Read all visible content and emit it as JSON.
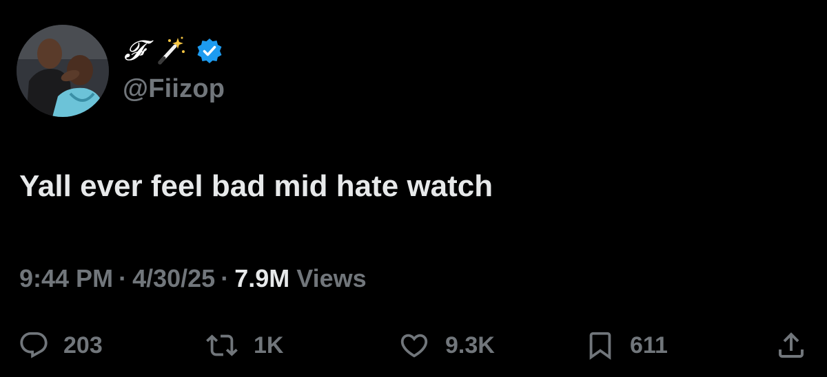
{
  "author": {
    "display_name_glyph": "𝓕",
    "handle": "@Fiizop",
    "verified": true,
    "badge_color": "#1d9bf0",
    "emoji_icon": "magic-wand-icon"
  },
  "tweet": {
    "text": "Yall ever feel bad mid hate watch"
  },
  "meta": {
    "time": "9:44 PM",
    "sep1": "·",
    "date": "4/30/25",
    "sep2": "·",
    "views_count": "7.9M",
    "views_label": "Views"
  },
  "actions": {
    "replies": {
      "icon": "reply-icon",
      "count": "203"
    },
    "reposts": {
      "icon": "repost-icon",
      "count": "1K"
    },
    "likes": {
      "icon": "heart-icon",
      "count": "9.3K"
    },
    "bookmarks": {
      "icon": "bookmark-icon",
      "count": "611"
    },
    "share": {
      "icon": "share-icon"
    }
  },
  "colors": {
    "background": "#000000",
    "primary_text": "#e7e9ea",
    "secondary_text": "#71767b",
    "verified_blue": "#1d9bf0"
  }
}
